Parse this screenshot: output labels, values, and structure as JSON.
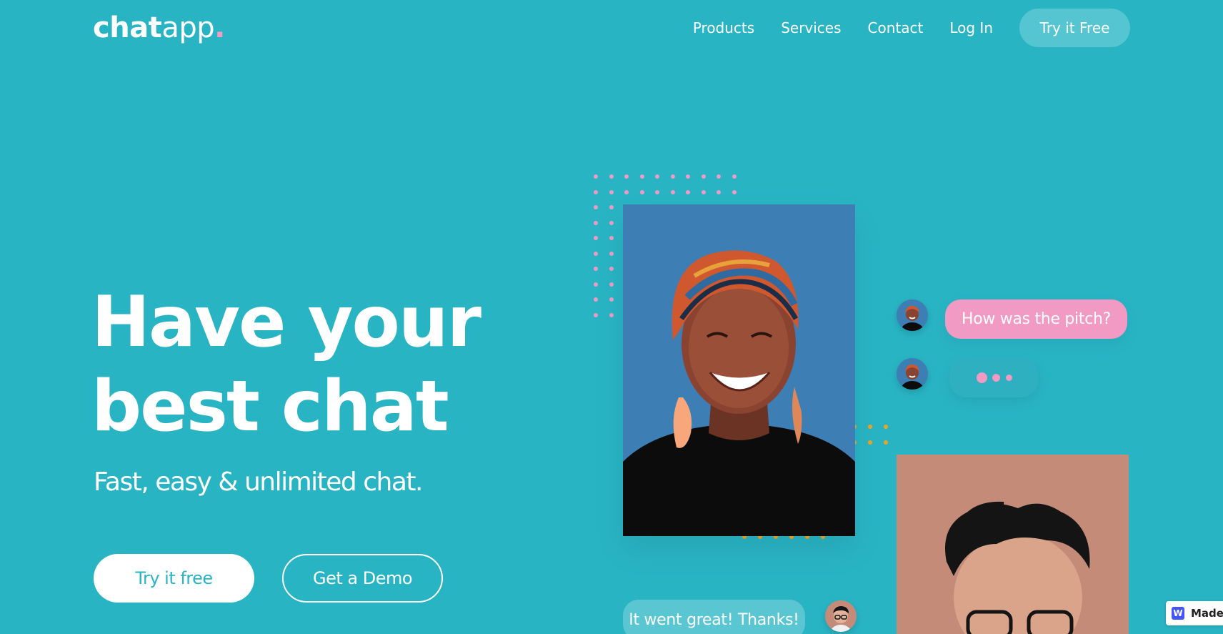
{
  "brand": {
    "logo_bold": "chat",
    "logo_light": "app",
    "logo_dot": "."
  },
  "nav": {
    "items": [
      {
        "label": "Products"
      },
      {
        "label": "Services"
      },
      {
        "label": "Contact"
      },
      {
        "label": "Log In"
      }
    ],
    "cta_label": "Try it Free"
  },
  "hero": {
    "headline_line1": "Have your",
    "headline_line2": "best chat",
    "subheadline": "Fast, easy & unlimited chat.",
    "primary_button": "Try it free",
    "secondary_button": "Get a Demo"
  },
  "chat": {
    "question": "How was the pitch?",
    "reply": "It went great! Thanks!"
  },
  "badge": {
    "icon_letter": "W",
    "label": "Made"
  },
  "colors": {
    "background": "#29b4c4",
    "pink": "#f09ac4",
    "orange": "#f5a21a",
    "photo_blue": "#3d7fb4",
    "photo_tan": "#c38b78"
  }
}
